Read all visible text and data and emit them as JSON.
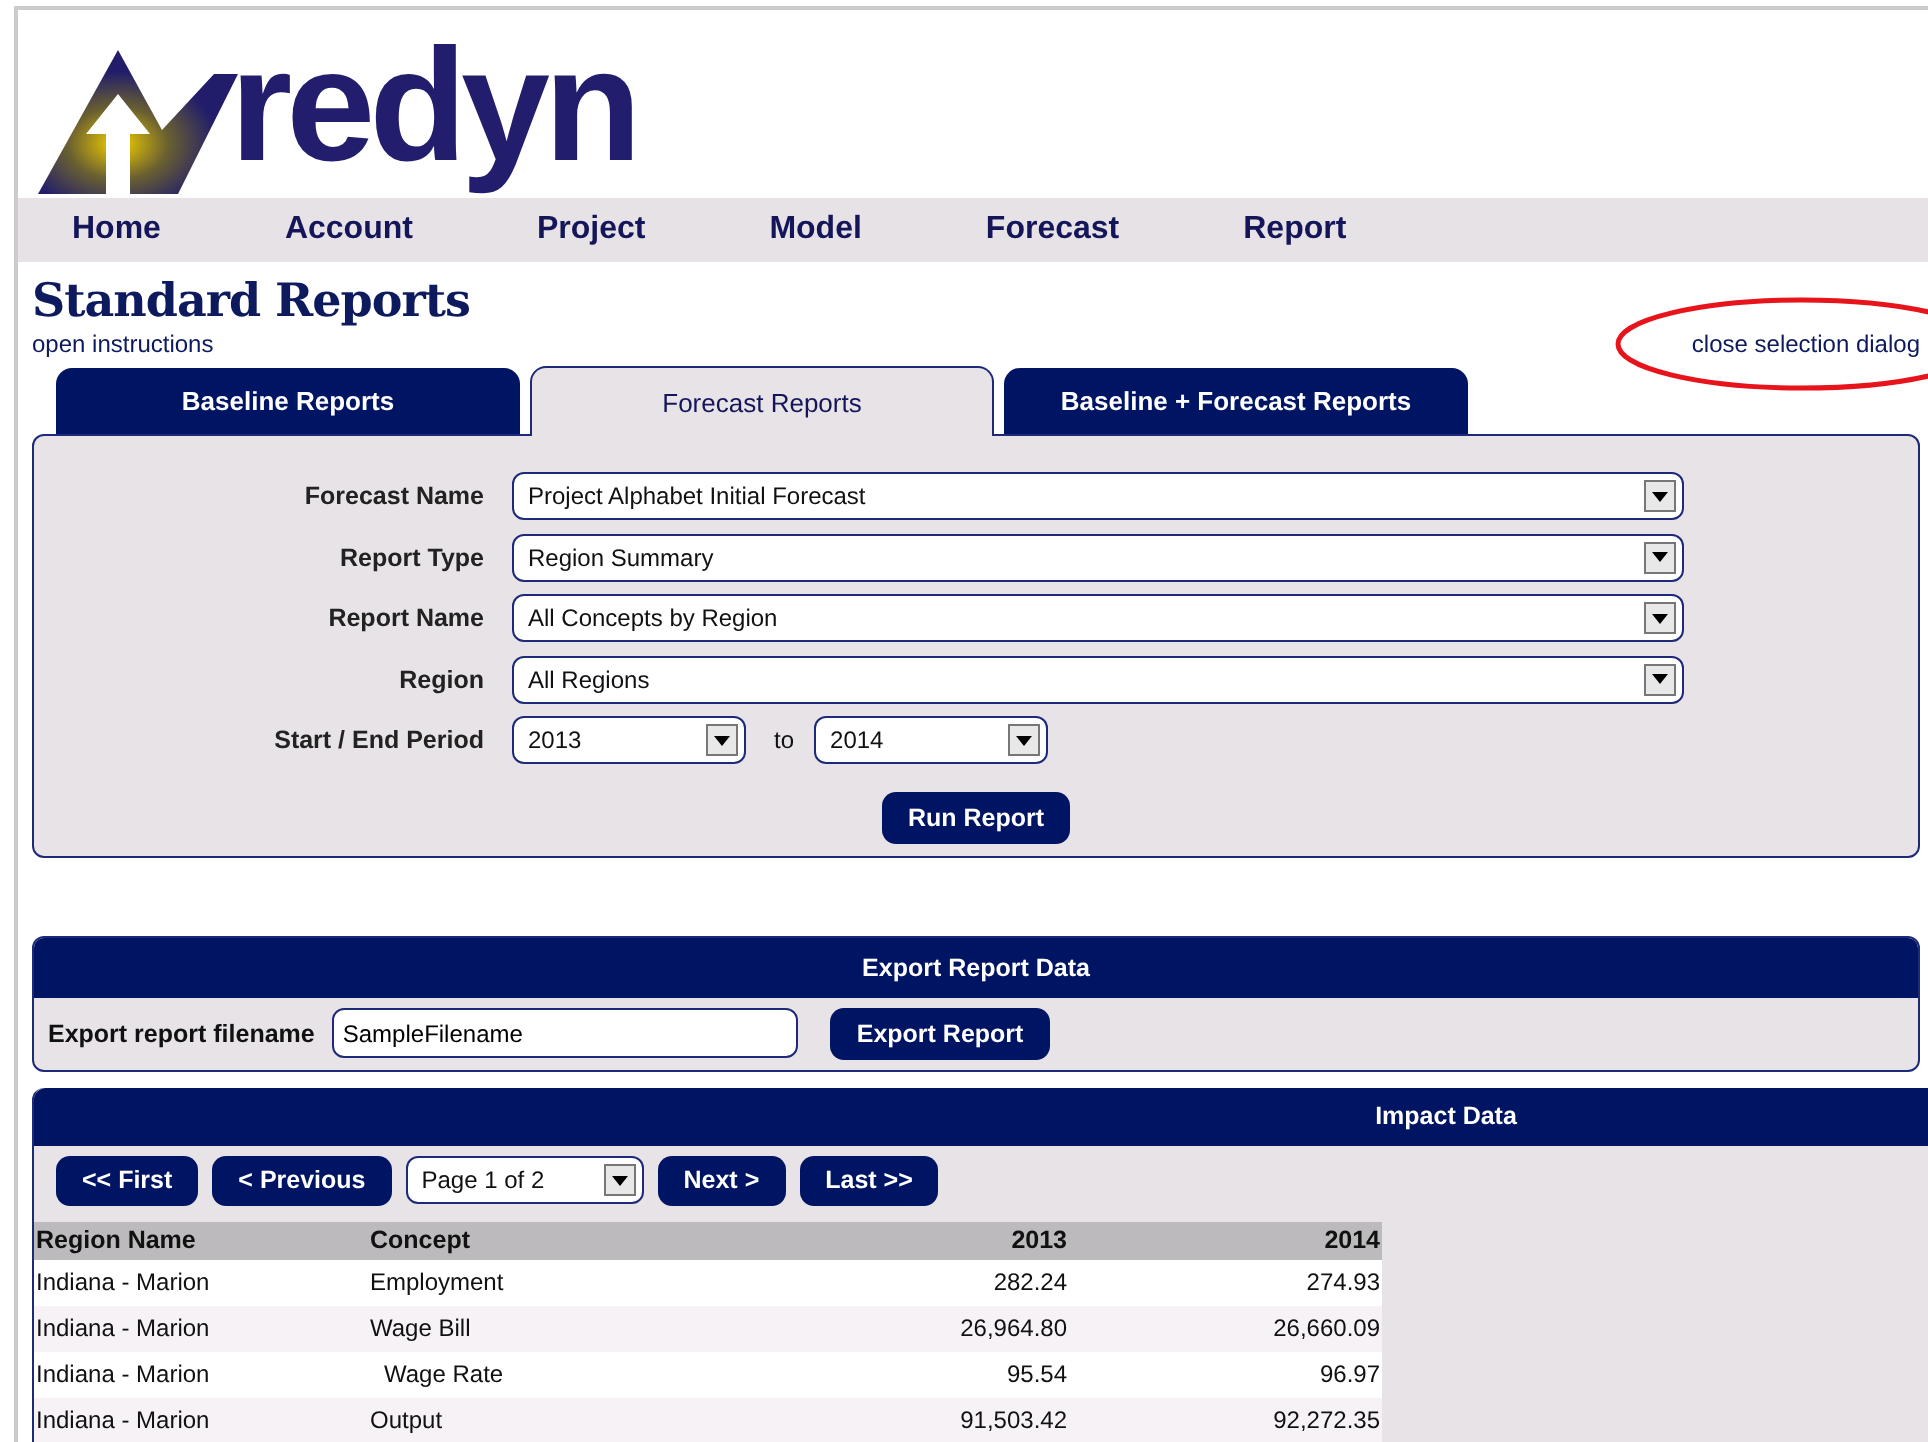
{
  "logo": {
    "text": "redyn"
  },
  "nav": [
    {
      "label": "Home"
    },
    {
      "label": "Account"
    },
    {
      "label": "Project"
    },
    {
      "label": "Model"
    },
    {
      "label": "Forecast"
    },
    {
      "label": "Report"
    }
  ],
  "page": {
    "title": "Standard Reports",
    "instructions_link": "open instructions",
    "close_link": "close selection dialog"
  },
  "tabs": [
    {
      "label": "Baseline Reports",
      "selected": false
    },
    {
      "label": "Forecast Reports",
      "selected": true
    },
    {
      "label": "Baseline + Forecast Reports",
      "selected": false
    }
  ],
  "form": {
    "fields": [
      {
        "label": "Forecast Name",
        "value": "Project Alphabet Initial Forecast"
      },
      {
        "label": "Report Type",
        "value": "Region Summary"
      },
      {
        "label": "Report Name",
        "value": "All Concepts by Region"
      },
      {
        "label": "Region",
        "value": "All Regions"
      }
    ],
    "period": {
      "label": "Start / End Period",
      "start": "2013",
      "separator": "to",
      "end": "2014"
    },
    "run_button": "Run Report"
  },
  "export": {
    "title": "Export Report Data",
    "label": "Export report filename",
    "value": "SampleFilename",
    "button": "Export Report"
  },
  "impact": {
    "title": "Impact Data",
    "pager": {
      "first": "<< First",
      "previous": "< Previous",
      "page": "Page 1 of 2",
      "next": "Next >",
      "last": "Last >>"
    },
    "columns": [
      "Region Name",
      "Concept",
      "2013",
      "2014"
    ],
    "rows": [
      {
        "kind": "concept",
        "region": "Indiana - Marion",
        "concept": "Employment",
        "values": [
          "282.24",
          "274.93"
        ]
      },
      {
        "kind": "concept",
        "region": "Indiana - Marion",
        "concept": "Wage Bill",
        "values": [
          "26,964.80",
          "26,660.09"
        ]
      },
      {
        "kind": "sub-concept",
        "region": "Indiana - Marion",
        "concept": "Wage Rate",
        "values": [
          "95.54",
          "96.97"
        ]
      },
      {
        "kind": "concept",
        "region": "Indiana - Marion",
        "concept": "Output",
        "values": [
          "91,503.42",
          "92,272.35"
        ]
      }
    ]
  }
}
